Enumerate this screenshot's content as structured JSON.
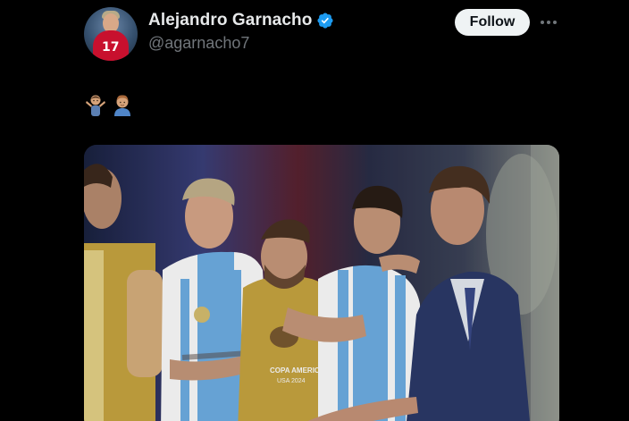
{
  "tweet": {
    "author": {
      "display_name": "Alejandro Garnacho",
      "handle": "@agarnacho7",
      "verified": true,
      "avatar_icon": "avatar-photo",
      "avatar_jersey_number": "17"
    },
    "follow_label": "Follow",
    "more_icon": "more-horizontal-icon",
    "text_emojis": [
      "man-shrugging-emoji",
      "man-face-emoji"
    ],
    "media": {
      "type": "photo",
      "patch_text_line1": "COPA AMERICA",
      "patch_text_line2": "USA 2024"
    }
  },
  "colors": {
    "background": "#000000",
    "primary_text": "#e7e9ea",
    "secondary_text": "#71767b",
    "verified_blue": "#1d9bf0",
    "follow_bg": "#eff3f4",
    "follow_text": "#0f1419"
  }
}
